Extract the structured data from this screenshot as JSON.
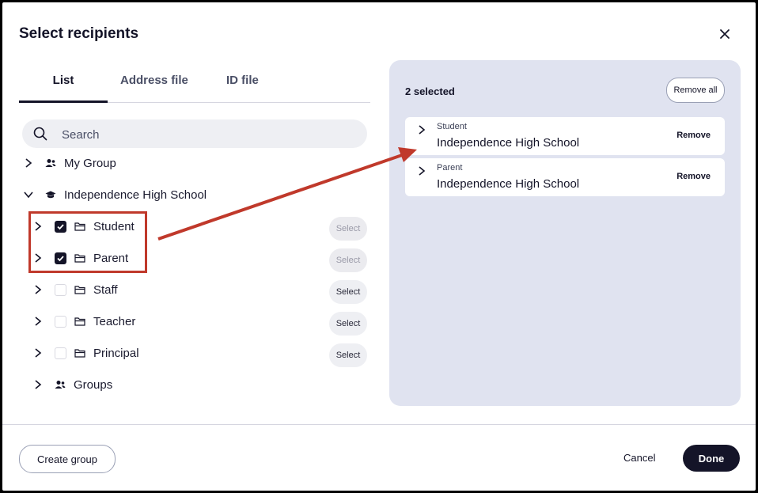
{
  "dialog": {
    "title": "Select recipients"
  },
  "tabs": [
    {
      "label": "List",
      "active": true
    },
    {
      "label": "Address file",
      "active": false
    },
    {
      "label": "ID file",
      "active": false
    }
  ],
  "search": {
    "placeholder": "Search",
    "value": ""
  },
  "tree": {
    "my_group": {
      "label": "My Group",
      "icon": "people-icon"
    },
    "school": {
      "label": "Independence High School",
      "icon": "graduation-cap-icon",
      "expanded": true
    },
    "items": [
      {
        "label": "Student",
        "checked": true,
        "select_label": "Select",
        "select_enabled": false,
        "icon": "folder-icon"
      },
      {
        "label": "Parent",
        "checked": true,
        "select_label": "Select",
        "select_enabled": false,
        "icon": "folder-icon"
      },
      {
        "label": "Staff",
        "checked": false,
        "select_label": "Select",
        "select_enabled": true,
        "icon": "folder-icon"
      },
      {
        "label": "Teacher",
        "checked": false,
        "select_label": "Select",
        "select_enabled": true,
        "icon": "folder-icon"
      },
      {
        "label": "Principal",
        "checked": false,
        "select_label": "Select",
        "select_enabled": true,
        "icon": "folder-icon"
      }
    ],
    "groups": {
      "label": "Groups",
      "icon": "people-icon"
    }
  },
  "selected_panel": {
    "count_label": "2 selected",
    "remove_all_label": "Remove all",
    "items": [
      {
        "type": "Student",
        "name": "Independence High School",
        "remove_label": "Remove"
      },
      {
        "type": "Parent",
        "name": "Independence High School",
        "remove_label": "Remove"
      }
    ]
  },
  "footer": {
    "create_group_label": "Create group",
    "cancel_label": "Cancel",
    "done_label": "Done"
  },
  "colors": {
    "primary": "#141428",
    "panel_bg": "#e0e3f0",
    "annotation": "#c0392b"
  }
}
